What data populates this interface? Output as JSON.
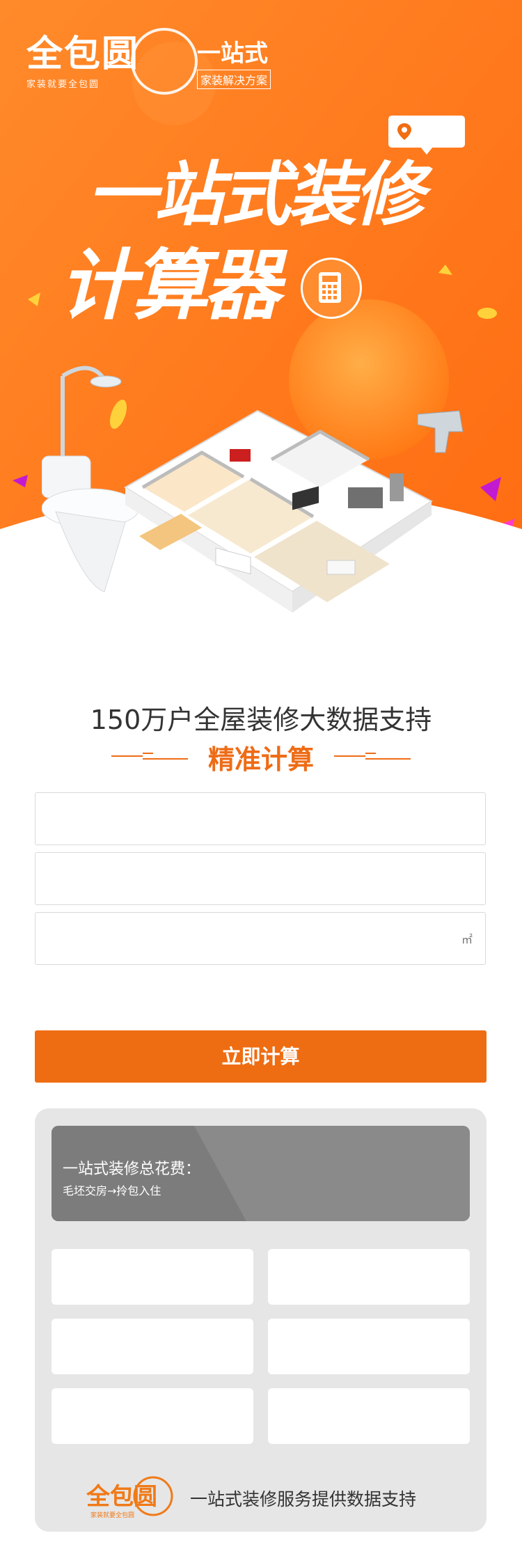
{
  "header": {
    "logo_text": "全包圆",
    "logo_slogan": "家装就要全包圆",
    "tag_main": "一站式",
    "tag_sub": "家装解决方案",
    "location_icon": "map-pin-icon"
  },
  "hero": {
    "title_line1": "一站式装修",
    "title_line2": "计算器",
    "badge_icon": "calculator-icon"
  },
  "intro": {
    "headline": "150万户全屋装修大数据支持",
    "subheadline": "精准计算"
  },
  "form": {
    "field1_value": "",
    "field2_value": "",
    "field3_value": "",
    "area_unit": "㎡",
    "submit_label": "立即计算"
  },
  "result": {
    "title": "一站式装修总花费：",
    "subtitle": "毛坯交房→拎包入住",
    "cells": [
      "",
      "",
      "",
      "",
      "",
      ""
    ]
  },
  "footer": {
    "logo_text": "全包圆",
    "logo_slogan": "家装就要全包圆",
    "text": "一站式装修服务提供数据支持"
  },
  "colors": {
    "brand_orange": "#ef6d12",
    "hero_orange": "#ff7d1f",
    "panel_gray": "#e6e6e6",
    "total_gray": "#888888"
  }
}
